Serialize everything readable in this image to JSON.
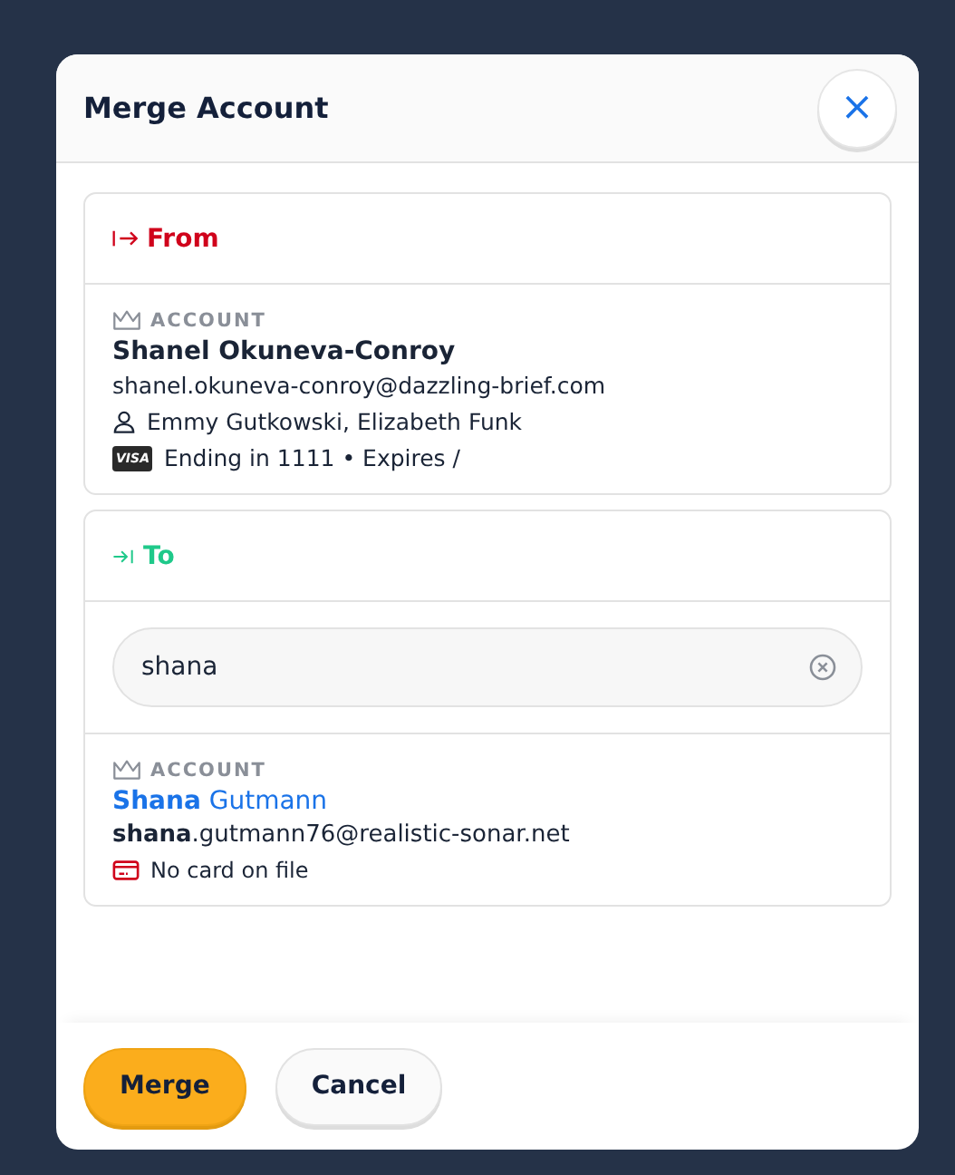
{
  "dialog": {
    "title": "Merge Account",
    "close_label": "×"
  },
  "from": {
    "heading": "From",
    "account_label": "ACCOUNT",
    "name": "Shanel Okuneva-Conroy",
    "email": "shanel.okuneva-conroy@dazzling-brief.com",
    "contacts": "Emmy Gutkowski, Elizabeth Funk",
    "card_brand": "VISA",
    "card": "Ending in 1111 • Expires /"
  },
  "to": {
    "heading": "To",
    "search": {
      "value": "shana"
    },
    "result": {
      "account_label": "ACCOUNT",
      "name": "**Shana** Gutmann",
      "email": "**shana**.gutmann76@realistic-sonar.net",
      "card": "No card on file"
    }
  },
  "buttons": [
    {
      "label": "Merge",
      "kind": "primary"
    },
    {
      "label": "Cancel",
      "kind": "secondary"
    }
  ]
}
